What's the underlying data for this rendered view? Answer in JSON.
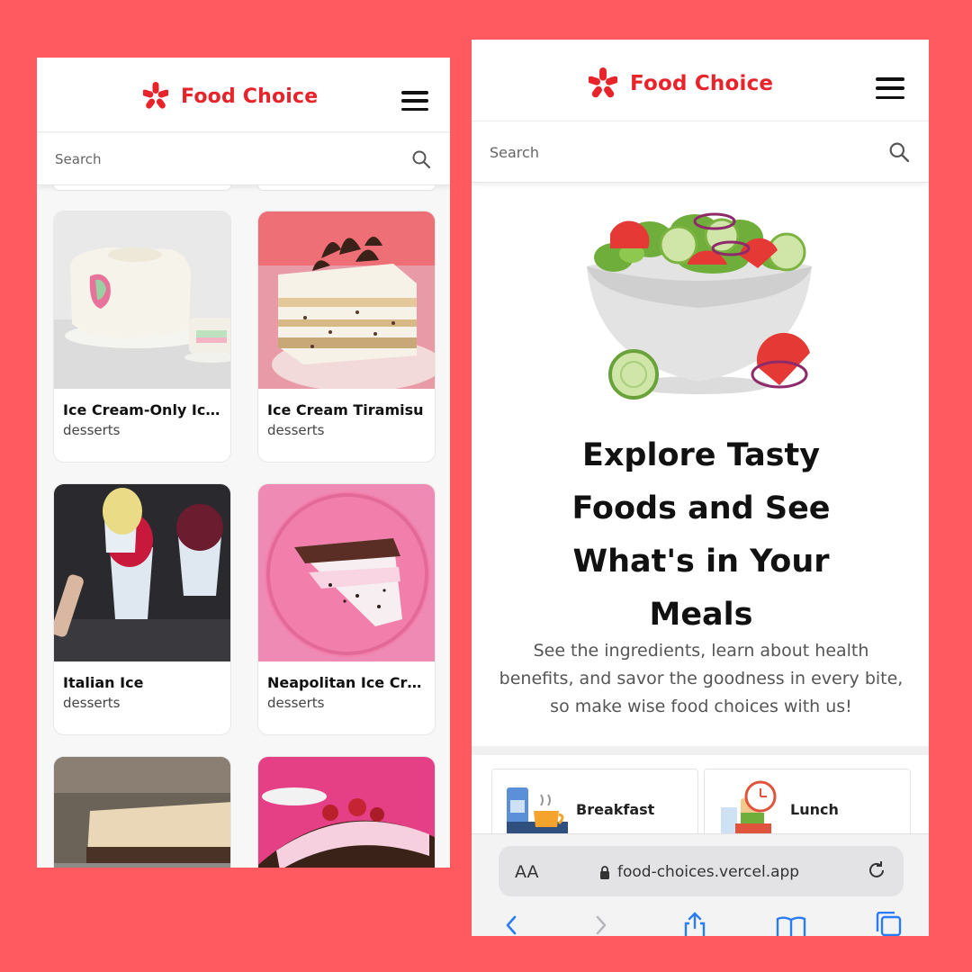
{
  "app": {
    "name": "Food Choice",
    "brand_color": "#E8232A",
    "frame_color": "#FF5A5F",
    "menu_icon": "hamburger-menu-icon",
    "logo_icon": "yelp-burst-icon"
  },
  "search": {
    "placeholder": "Search",
    "icon": "search-icon"
  },
  "left_screen": {
    "cards": [
      {
        "title": "Ice Cream-Only Ic...",
        "category": "desserts"
      },
      {
        "title": "Ice Cream Tiramisu",
        "category": "desserts"
      },
      {
        "title": "Italian Ice",
        "category": "desserts"
      },
      {
        "title": "Neapolitan Ice Cre...",
        "category": "desserts"
      },
      {
        "title": "",
        "category": ""
      },
      {
        "title": "",
        "category": ""
      }
    ]
  },
  "right_screen": {
    "hero_title": "Explore Tasty Foods and See What's in Your Meals",
    "hero_subtitle": "See the ingredients, learn about health benefits, and savor the goodness in every bite, so make wise food choices with us!",
    "categories": [
      {
        "label": "Breakfast",
        "icon": "breakfast-icon"
      },
      {
        "label": "Lunch",
        "icon": "lunch-icon"
      }
    ],
    "browser": {
      "text_size_label": "AA",
      "url": "food-choices.vercel.app",
      "lock_icon": "lock-icon",
      "reload_icon": "reload-icon",
      "nav_icons": [
        "back-icon",
        "forward-icon",
        "share-icon",
        "bookmarks-icon",
        "tabs-icon"
      ]
    }
  }
}
